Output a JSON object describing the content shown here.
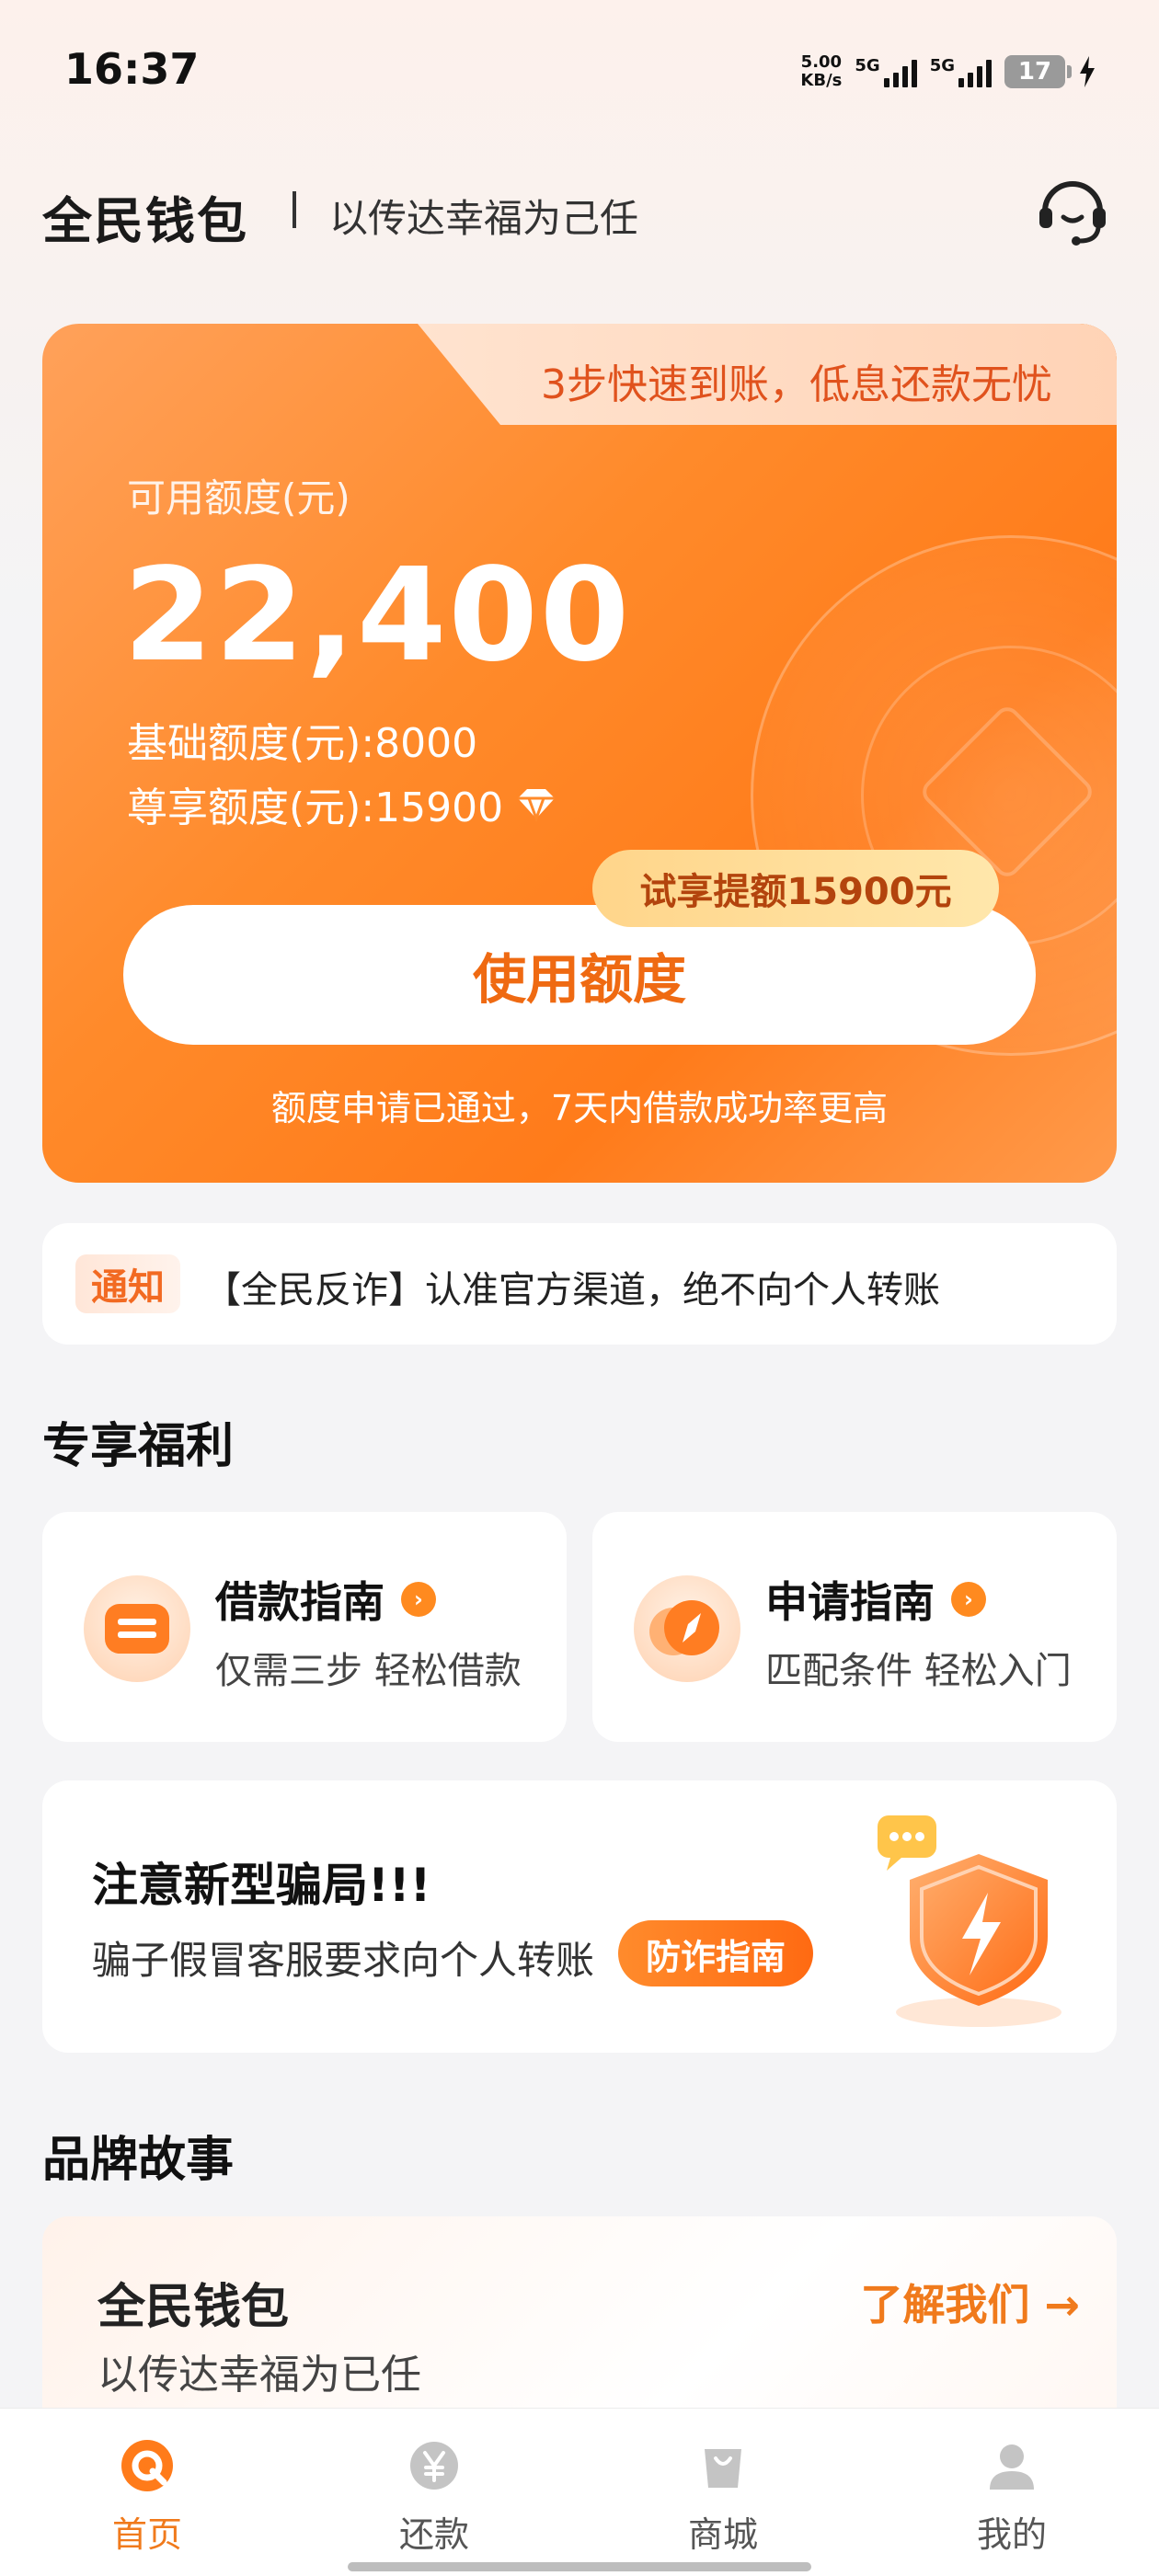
{
  "status": {
    "time": "16:37",
    "speed_value": "5.00",
    "speed_unit": "KB/s",
    "network1": "5G",
    "network2": "5G",
    "battery": "17"
  },
  "header": {
    "brand": "全民钱包",
    "slogan": "以传达幸福为己任",
    "support_icon": "headset-icon"
  },
  "credit_card": {
    "banner": "3步快速到账，低息还款无忧",
    "available_label": "可用额度(元)",
    "available_amount": "22,400",
    "basic_credit": "基础额度(元):8000",
    "vip_credit": "尊享额度(元):15900",
    "trial_badge": "试享提额15900元",
    "use_button": "使用额度",
    "approved_tip": "额度申请已通过，7天内借款成功率更高"
  },
  "notice": {
    "tag": "通知",
    "text": "【全民反诈】认准官方渠道，绝不向个人转账"
  },
  "welfare": {
    "title": "专享福利",
    "items": [
      {
        "title": "借款指南",
        "subtitle": "仅需三步 轻松借款",
        "icon": "loan-guide-icon"
      },
      {
        "title": "申请指南",
        "subtitle": "匹配条件 轻松入门",
        "icon": "compass-icon"
      }
    ]
  },
  "fraud": {
    "title": "注意新型骗局!!!",
    "text": "骗子假冒客服要求向个人转账",
    "button": "防诈指南"
  },
  "story": {
    "section_title": "品牌故事",
    "title": "全民钱包",
    "subtitle": "以传达幸福为已任",
    "link": "了解我们 →"
  },
  "nav": {
    "items": [
      {
        "label": "首页",
        "active": true
      },
      {
        "label": "还款",
        "active": false
      },
      {
        "label": "商城",
        "active": false
      },
      {
        "label": "我的",
        "active": false
      }
    ]
  },
  "colors": {
    "accent": "#FF7B1A",
    "accent_text": "#F07A1C",
    "background": "#F4F4F6"
  }
}
